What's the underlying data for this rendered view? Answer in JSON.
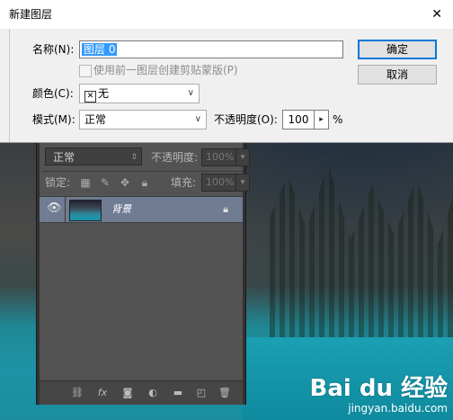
{
  "dialog": {
    "title": "新建图层",
    "name_label": "名称(N):",
    "name_value": "图层 0",
    "clip_checkbox_label": "使用前一图层创建剪贴蒙版(P)",
    "color_label": "颜色(C):",
    "color_value": "无",
    "mode_label": "模式(M):",
    "mode_value": "正常",
    "opacity_label": "不透明度(O):",
    "opacity_value": "100",
    "opacity_unit": "%",
    "ok_button": "确定",
    "cancel_button": "取消"
  },
  "layers_panel": {
    "blend_mode": "正常",
    "opacity_label": "不透明度:",
    "opacity_value": "100%",
    "lock_label": "锁定:",
    "fill_label": "填充:",
    "fill_value": "100%",
    "layer_name": "背景"
  },
  "watermark": {
    "logo": "Bai du 经验",
    "url": "jingyan.baidu.com"
  },
  "colors": {
    "selection": "#3399ff",
    "layer_selected": "#6f7c92",
    "panel_bg": "#535353",
    "lake": "#1aa0b4"
  }
}
